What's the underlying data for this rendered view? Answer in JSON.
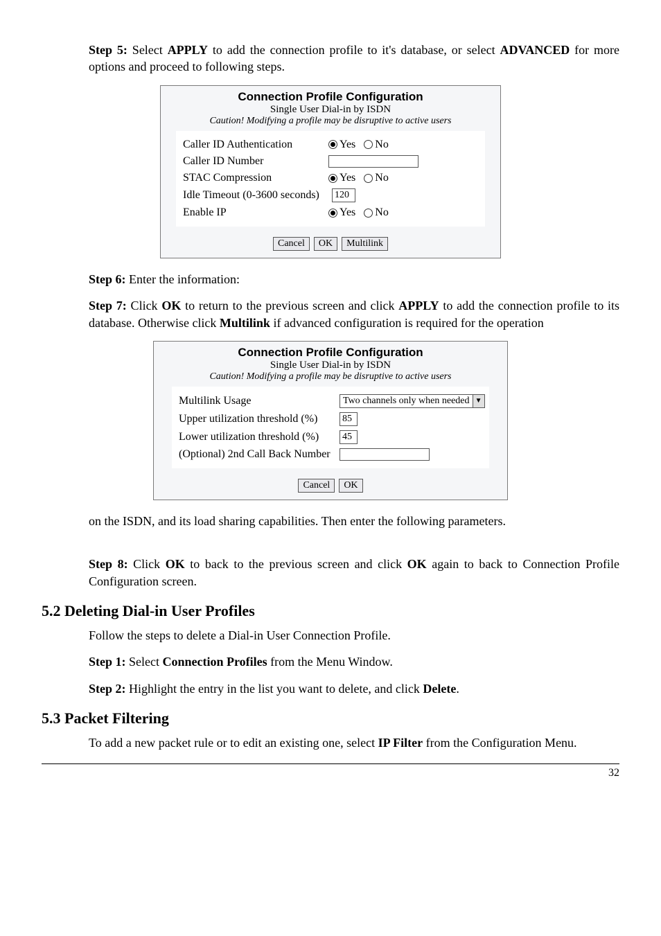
{
  "step5": {
    "label": "Step 5:",
    "text_before_apply": " Select ",
    "apply": "APPLY",
    "text_mid": " to add the connection profile to it's database, or select ",
    "advanced": "ADVANCED",
    "text_after": " for more options and proceed to following steps."
  },
  "fig1": {
    "title": "Connection Profile Configuration",
    "subtitle": "Single User Dial-in by ISDN",
    "caution": "Caution! Modifying a profile may be disruptive to active users",
    "rows": {
      "caller_id_auth_label": "Caller ID Authentication",
      "caller_id_number_label": "Caller ID Number",
      "stac_label": "STAC Compression",
      "idle_label": "Idle Timeout (0-3600 seconds)",
      "idle_value": "120",
      "enable_ip_label": "Enable IP"
    },
    "yes": "Yes",
    "no": "No",
    "buttons": {
      "cancel": "Cancel",
      "ok": "OK",
      "multilink": "Multilink"
    }
  },
  "step6": {
    "label": "Step 6:",
    "text": " Enter the information:"
  },
  "step7": {
    "label": "Step 7:",
    "t1": " Click ",
    "ok": "OK",
    "t2": " to return to the previous screen and click ",
    "apply": "APPLY",
    "t3": " to add the connection profile to its database. Otherwise click ",
    "multilink": "Multilink",
    "t4": " if advanced configuration is required for the operation"
  },
  "fig2": {
    "title": "Connection Profile Configuration",
    "subtitle": "Single User Dial-in by ISDN",
    "caution": "Caution! Modifying a profile may be disruptive to active users",
    "rows": {
      "multilink_label": "Multilink Usage",
      "multilink_value": "Two channels only when needed",
      "upper_label": "Upper utilization threshold (%)",
      "upper_value": "85",
      "lower_label": "Lower utilization threshold (%)",
      "lower_value": "45",
      "callback_label": "(Optional) 2nd Call Back Number"
    },
    "buttons": {
      "cancel": "Cancel",
      "ok": "OK"
    }
  },
  "after_fig2": "on the ISDN, and its load sharing capabilities. Then enter the following parameters.",
  "step8": {
    "label": "Step 8:",
    "t1": " Click ",
    "ok1": "OK",
    "t2": " to back to the previous screen and click ",
    "ok2": "OK",
    "t3": " again to back to Connection Profile Configuration screen."
  },
  "sec52": {
    "heading": "5.2 Deleting Dial-in User Profiles",
    "intro": "Follow the steps to delete a Dial-in User Connection Profile.",
    "step1_label": "Step 1:",
    "step1_t1": " Select ",
    "step1_bold": "Connection Profiles",
    "step1_t2": " from the Menu Window.",
    "step2_label": "Step 2:",
    "step2_t1": " Highlight the entry in the list you want to delete, and click ",
    "step2_bold": "Delete",
    "step2_t2": "."
  },
  "sec53": {
    "heading": "5.3 Packet Filtering",
    "t1": "To add a new packet rule or to edit an existing one, select ",
    "bold": "IP Filter",
    "t2": " from the Configuration Menu."
  },
  "page_number": "32"
}
